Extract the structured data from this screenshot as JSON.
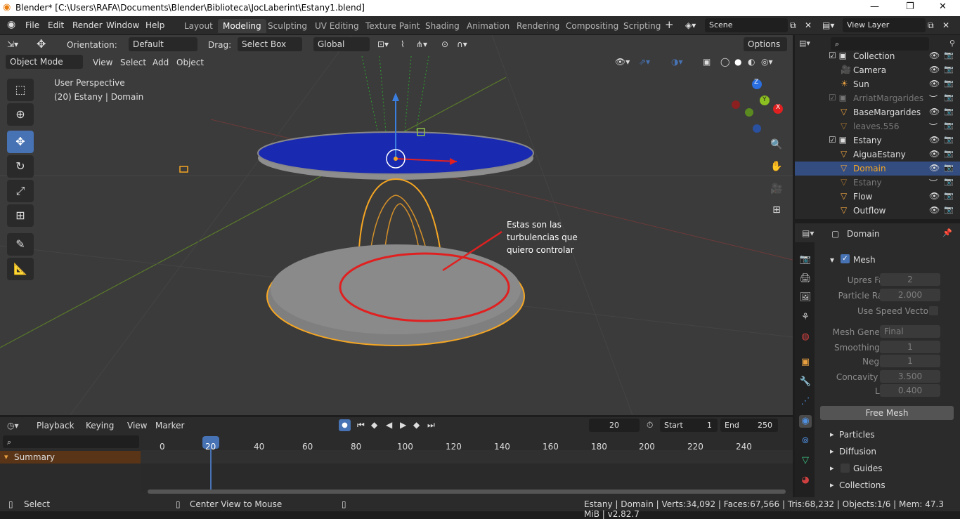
{
  "window": {
    "title": "Blender* [C:\\Users\\RAFA\\Documents\\Blender\\Biblioteca\\JocLaberint\\Estany1.blend]"
  },
  "menu": {
    "items": [
      "File",
      "Edit",
      "Render",
      "Window",
      "Help"
    ]
  },
  "workspaces": [
    "Layout",
    "Modeling",
    "Sculpting",
    "UV Editing",
    "Texture Paint",
    "Shading",
    "Animation",
    "Rendering",
    "Compositing",
    "Scripting"
  ],
  "scene": "Scene",
  "view_layer": "View Layer",
  "tool_header": {
    "orientation_label": "Orientation:",
    "orientation_value": "Default",
    "drag_label": "Drag:",
    "drag_value": "Select Box",
    "transform": "Global",
    "options": "Options"
  },
  "viewport_header": {
    "mode": "Object Mode",
    "view": "View",
    "select": "Select",
    "add": "Add",
    "object": "Object"
  },
  "viewport": {
    "perspective": "User Perspective",
    "object_info": "(20) Estany | Domain",
    "annotation": "Estas son las\nturbulencias que\nquiero controlar"
  },
  "outliner": {
    "rows": [
      {
        "label": "Collection",
        "dim": false
      },
      {
        "label": "Camera",
        "dim": false
      },
      {
        "label": "Sun",
        "dim": false
      },
      {
        "label": "ArriatMargarides",
        "dim": true
      },
      {
        "label": "BaseMargarides",
        "dim": false
      },
      {
        "label": "leaves.556",
        "dim": true
      },
      {
        "label": "Estany",
        "dim": false
      },
      {
        "label": "AiguaEstany",
        "dim": false
      },
      {
        "label": "Domain",
        "dim": false
      },
      {
        "label": "Estany",
        "dim": true
      },
      {
        "label": "Flow",
        "dim": false
      },
      {
        "label": "Outflow",
        "dim": false
      }
    ]
  },
  "properties": {
    "object_name": "Domain",
    "mesh_label": "Mesh",
    "fields": [
      {
        "label": "Upres Factor",
        "value": "2"
      },
      {
        "label": "Particle Radius",
        "value": "2.000"
      }
    ],
    "use_speed_vectors": "Use Speed Vectors",
    "mesh_generator": {
      "label": "Mesh Generator",
      "value": "Final"
    },
    "fields2": [
      {
        "label": "Smoothing Po...",
        "value": "1"
      },
      {
        "label": "Negative",
        "value": "1"
      },
      {
        "label": "Concavity Up...",
        "value": "3.500"
      },
      {
        "label": "Lower",
        "value": "0.400"
      }
    ],
    "free_mesh": "Free Mesh",
    "panels": [
      "Particles",
      "Diffusion",
      "Guides",
      "Collections"
    ]
  },
  "timeline": {
    "playback": "Playback",
    "keying": "Keying",
    "view": "View",
    "marker": "Marker",
    "current_frame": "20",
    "start_label": "Start",
    "start": "1",
    "end_label": "End",
    "end": "250",
    "summary": "Summary",
    "ticks": [
      "0",
      "20",
      "40",
      "60",
      "80",
      "100",
      "120",
      "140",
      "160",
      "180",
      "200",
      "220",
      "240"
    ]
  },
  "status": {
    "select": "Select",
    "center": "Center View to Mouse",
    "info": "Estany | Domain | Verts:34,092 | Faces:67,566 | Tris:68,232 | Objects:1/6 | Mem: 47.3 MiB | v2.82.7"
  },
  "colors": {
    "accent": "#4772b3",
    "selected_orange": "#f5a623",
    "annotation_red": "#e02020",
    "water_blue": "#1a2ab0"
  }
}
